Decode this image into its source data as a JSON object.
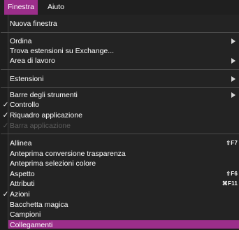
{
  "menubar": {
    "items": [
      {
        "label": "Finestra",
        "active": true
      },
      {
        "label": "Aiuto",
        "active": false
      }
    ]
  },
  "menu": {
    "items": [
      {
        "label": "Nuova finestra"
      },
      {
        "label": "Ordina",
        "submenu": true
      },
      {
        "label": "Trova estensioni su Exchange..."
      },
      {
        "label": "Area di lavoro",
        "submenu": true
      },
      {
        "label": "Estensioni",
        "submenu": true
      },
      {
        "label": "Barre degli strumenti",
        "submenu": true
      },
      {
        "label": "Controllo",
        "checked": true
      },
      {
        "label": "Riquadro applicazione",
        "checked": true
      },
      {
        "label": "Barra applicazione",
        "checked": true,
        "disabled": true
      },
      {
        "label": "Allinea",
        "shortcut": "⇧F7"
      },
      {
        "label": "Anteprima conversione trasparenza"
      },
      {
        "label": "Anteprima selezioni colore"
      },
      {
        "label": "Aspetto",
        "shortcut": "⇧F6"
      },
      {
        "label": "Attributi",
        "shortcut": "⌘F11"
      },
      {
        "label": "Azioni",
        "checked": true
      },
      {
        "label": "Bacchetta magica"
      },
      {
        "label": "Campioni"
      },
      {
        "label": "Collegamenti",
        "highlighted": true
      }
    ]
  },
  "colors": {
    "accent": "#9b2e8a",
    "menu_bg": "#232323",
    "disabled_text": "#5d5d5d"
  },
  "icons": {
    "check": "✓",
    "submenu": "chevron-right-icon"
  }
}
